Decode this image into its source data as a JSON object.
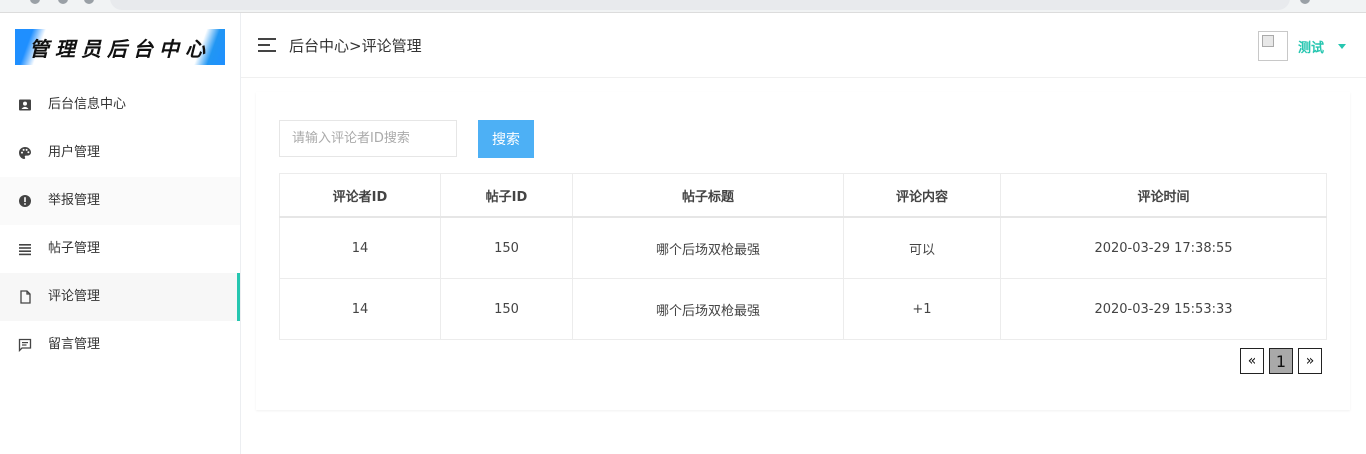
{
  "sidebar": {
    "logo_text": "管理员后台中心",
    "items": [
      {
        "label": "后台信息中心",
        "icon": "id-card-icon"
      },
      {
        "label": "用户管理",
        "icon": "palette-icon"
      },
      {
        "label": "举报管理",
        "icon": "alert-circle-icon"
      },
      {
        "label": "帖子管理",
        "icon": "list-icon"
      },
      {
        "label": "评论管理",
        "icon": "file-icon"
      },
      {
        "label": "留言管理",
        "icon": "message-icon"
      }
    ],
    "active_index": 4
  },
  "header": {
    "breadcrumb": "后台中心>评论管理",
    "username": "测试"
  },
  "search": {
    "placeholder": "请输入评论者ID搜索",
    "value": "",
    "button_label": "搜索"
  },
  "table": {
    "columns": [
      "评论者ID",
      "帖子ID",
      "帖子标题",
      "评论内容",
      "评论时间"
    ],
    "rows": [
      [
        "14",
        "150",
        "哪个后场双枪最强",
        "可以",
        "2020-03-29 17:38:55"
      ],
      [
        "14",
        "150",
        "哪个后场双枪最强",
        "+1",
        "2020-03-29 15:53:33"
      ]
    ]
  },
  "pagination": {
    "prev": "«",
    "current": "1",
    "next": "»"
  },
  "colors": {
    "accent": "#26c6b0",
    "button": "#4db0f5"
  }
}
